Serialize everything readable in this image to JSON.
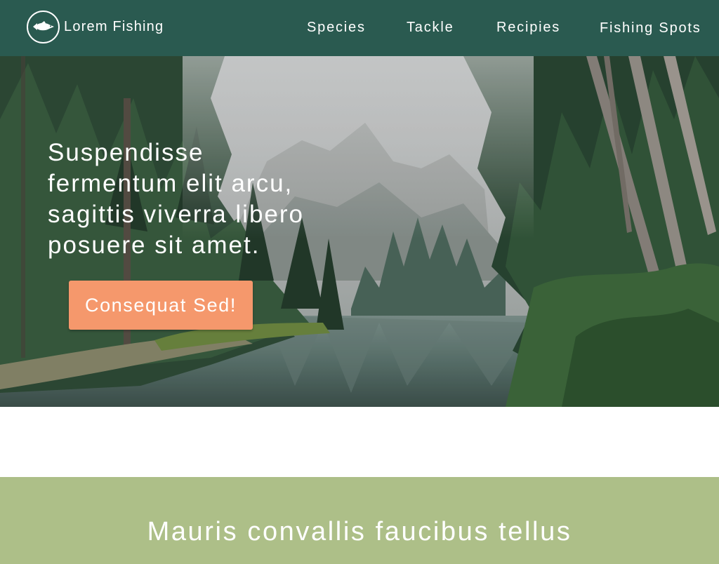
{
  "brand": {
    "name": "Lorem Fishing",
    "logo_icon": "fish-icon"
  },
  "nav": {
    "items": [
      {
        "label": "Species"
      },
      {
        "label": "Tackle"
      },
      {
        "label": "Recipies"
      },
      {
        "label": "Fishing Spots"
      }
    ]
  },
  "hero": {
    "headline": "Suspendisse fermentum elit arcu, sagittis viverra libero posuere sit amet.",
    "cta_label": "Consequat Sed!",
    "background": "forest-lake-mountain-photo"
  },
  "section": {
    "heading": "Mauris convallis faucibus tellus"
  },
  "colors": {
    "navbar": "#2a5a50",
    "cta": "#f5986c",
    "section_band": "#adbf88",
    "text": "#ffffff"
  }
}
